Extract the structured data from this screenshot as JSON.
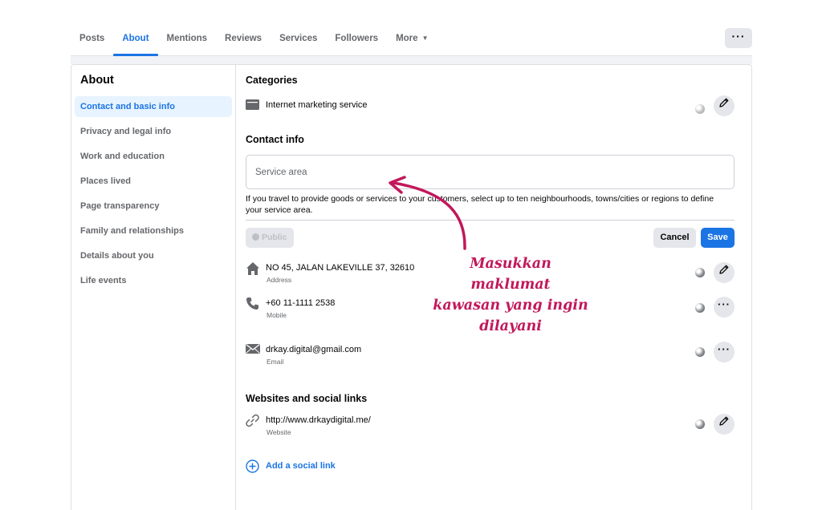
{
  "tabs": [
    {
      "label": "Posts"
    },
    {
      "label": "About"
    },
    {
      "label": "Mentions"
    },
    {
      "label": "Reviews"
    },
    {
      "label": "Services"
    },
    {
      "label": "Followers"
    },
    {
      "label": "More"
    }
  ],
  "more_button": "···",
  "sidebar": {
    "title": "About",
    "items": [
      {
        "label": "Contact and basic info"
      },
      {
        "label": "Privacy and legal info"
      },
      {
        "label": "Work and education"
      },
      {
        "label": "Places lived"
      },
      {
        "label": "Page transparency"
      },
      {
        "label": "Family and relationships"
      },
      {
        "label": "Details about you"
      },
      {
        "label": "Life events"
      }
    ]
  },
  "categories": {
    "title": "Categories",
    "item": "Internet marketing service"
  },
  "contact": {
    "title": "Contact info",
    "service_area_placeholder": "Service area",
    "help_text": "If you travel to provide goods or services to your customers, select up to ten neighbourhoods, towns/cities or regions to define your service area.",
    "public_label": "Public",
    "cancel_label": "Cancel",
    "save_label": "Save",
    "address": {
      "value": "NO 45, JALAN LAKEVILLE 37, 32610",
      "label": "Address"
    },
    "phone": {
      "value": "+60 11-1111 2538",
      "label": "Mobile"
    },
    "email": {
      "value": "drkay.digital@gmail.com",
      "label": "Email"
    }
  },
  "websites": {
    "title": "Websites and social links",
    "website": {
      "value": "http://www.drkaydigital.me/",
      "label": "Website"
    },
    "add_link_label": "Add a social link"
  },
  "annotation": {
    "line1": "Masukkan maklumat",
    "line2": "kawasan yang ingin",
    "line3": "dilayani",
    "color": "#c2185b"
  },
  "colors": {
    "accent": "#1b74e4",
    "muted_text": "#65676b",
    "button_gray": "#e4e6eb"
  }
}
